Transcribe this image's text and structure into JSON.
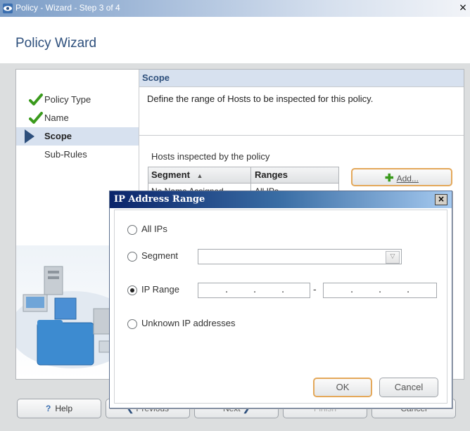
{
  "window": {
    "title": "Policy - Wizard - Step 3 of 4",
    "close_glyph": "×"
  },
  "header": {
    "title": "Policy Wizard"
  },
  "steps": [
    {
      "label": "Policy Type",
      "state": "done"
    },
    {
      "label": "Name",
      "state": "done"
    },
    {
      "label": "Scope",
      "state": "active"
    },
    {
      "label": "Sub-Rules",
      "state": "pending"
    }
  ],
  "scope": {
    "title": "Scope",
    "description": "Define the range of Hosts to be inspected for this policy.",
    "hosts_label": "Hosts inspected by the policy",
    "table": {
      "columns": [
        "Segment",
        "Ranges"
      ],
      "sort_indicator": "▲",
      "rows": [
        [
          "No Name Assigned",
          "All IPs"
        ]
      ]
    },
    "add_label": "Add..."
  },
  "footer": {
    "help_label": "Help",
    "previous_label": "Previous",
    "next_label": "Next",
    "finish_label": "Finish",
    "cancel_label": "Cancel"
  },
  "dialog": {
    "title": "IP Address Range",
    "close_glyph": "×",
    "options": {
      "all_ips": "All IPs",
      "segment": "Segment",
      "ip_range": "IP Range",
      "unknown": "Unknown IP addresses"
    },
    "selected": "ip_range",
    "segment_value": "",
    "ok_label": "OK",
    "cancel_label": "Cancel"
  },
  "colors": {
    "accent": "#2d4f7c",
    "focus": "#e4a85a",
    "check": "#3a9a1c",
    "add": "#3a9a1c"
  }
}
